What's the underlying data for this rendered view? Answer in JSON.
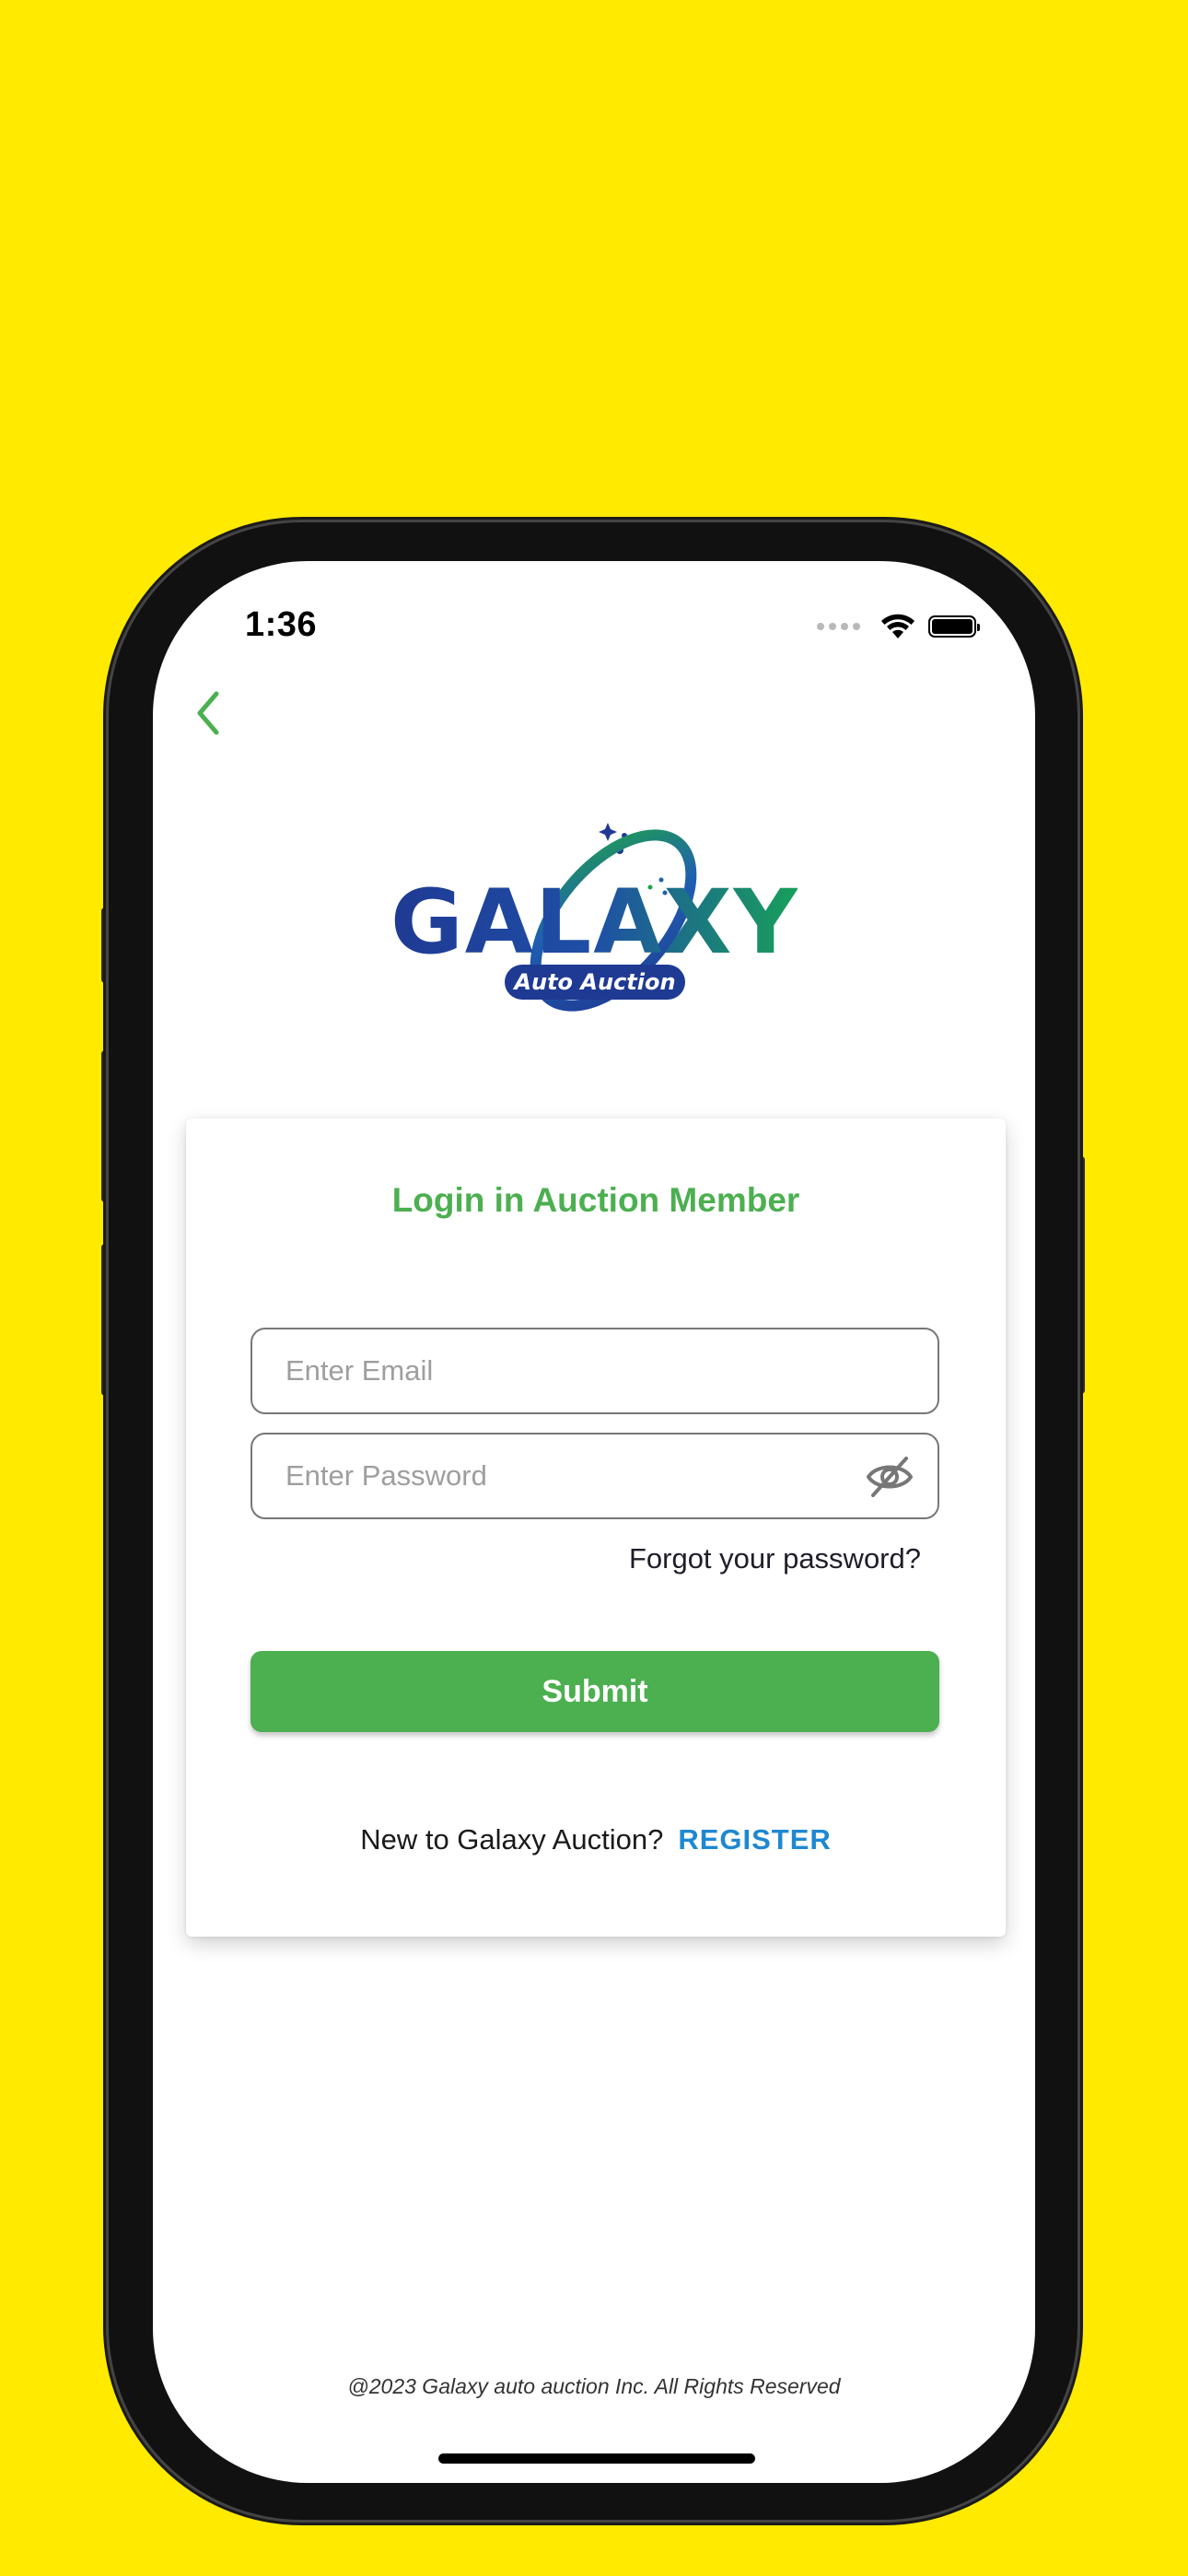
{
  "status_bar": {
    "time": "1:36"
  },
  "brand": {
    "logo_primary": "GALAXY",
    "logo_secondary": "Auto Auction",
    "green": "#4caf50",
    "blue": "#1e88d1",
    "navy": "#1f3a93"
  },
  "login": {
    "title": "Login in Auction Member",
    "email_placeholder": "Enter Email",
    "password_placeholder": "Enter Password",
    "forgot_label": "Forgot your password?",
    "submit_label": "Submit",
    "register_prompt": "New to Galaxy Auction?",
    "register_label": "REGISTER"
  },
  "icons": {
    "back": "chevron-left-icon",
    "password_toggle": "eye-off-icon",
    "wifi": "wifi-icon",
    "battery": "battery-icon"
  },
  "footer": {
    "copyright": "@2023  Galaxy auto auction Inc. All Rights Reserved"
  },
  "background_color": "#ffea00"
}
